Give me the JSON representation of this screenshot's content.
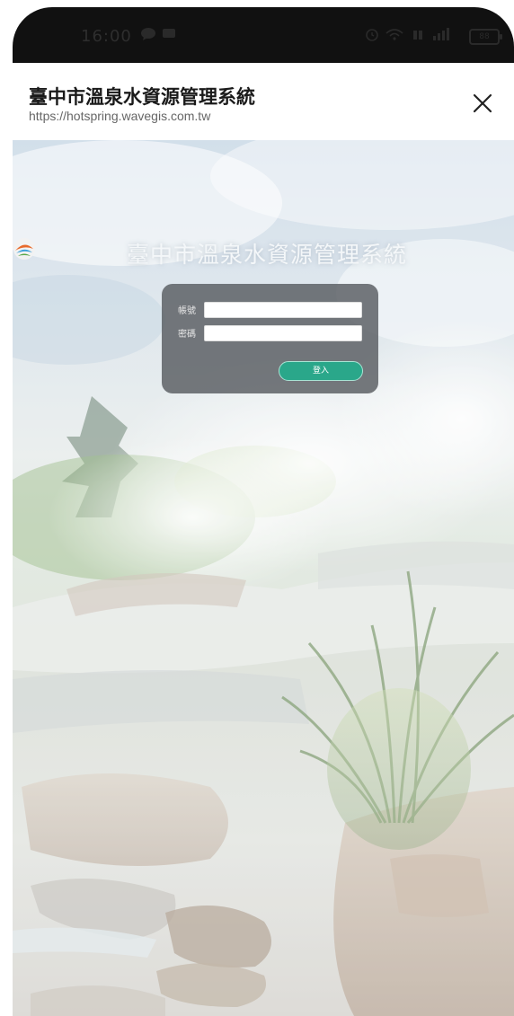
{
  "status_bar": {
    "time": "16:00",
    "battery": "88"
  },
  "header": {
    "title": "臺中市溫泉水資源管理系統",
    "url": "https://hotspring.wavegis.com.tw"
  },
  "brand": {
    "title": "臺中市溫泉水資源管理系統"
  },
  "login": {
    "account_label": "帳號",
    "password_label": "密碼",
    "submit_label": "登入"
  },
  "colors": {
    "status_bar_bg": "#111111",
    "button_accent": "#2aa78a",
    "panel_bg": "#585c60"
  },
  "icons": [
    "message-icon",
    "image-icon",
    "alarm-icon",
    "signal-icon",
    "wifi-icon",
    "battery-icon",
    "close-icon",
    "brand-logo-icon"
  ]
}
